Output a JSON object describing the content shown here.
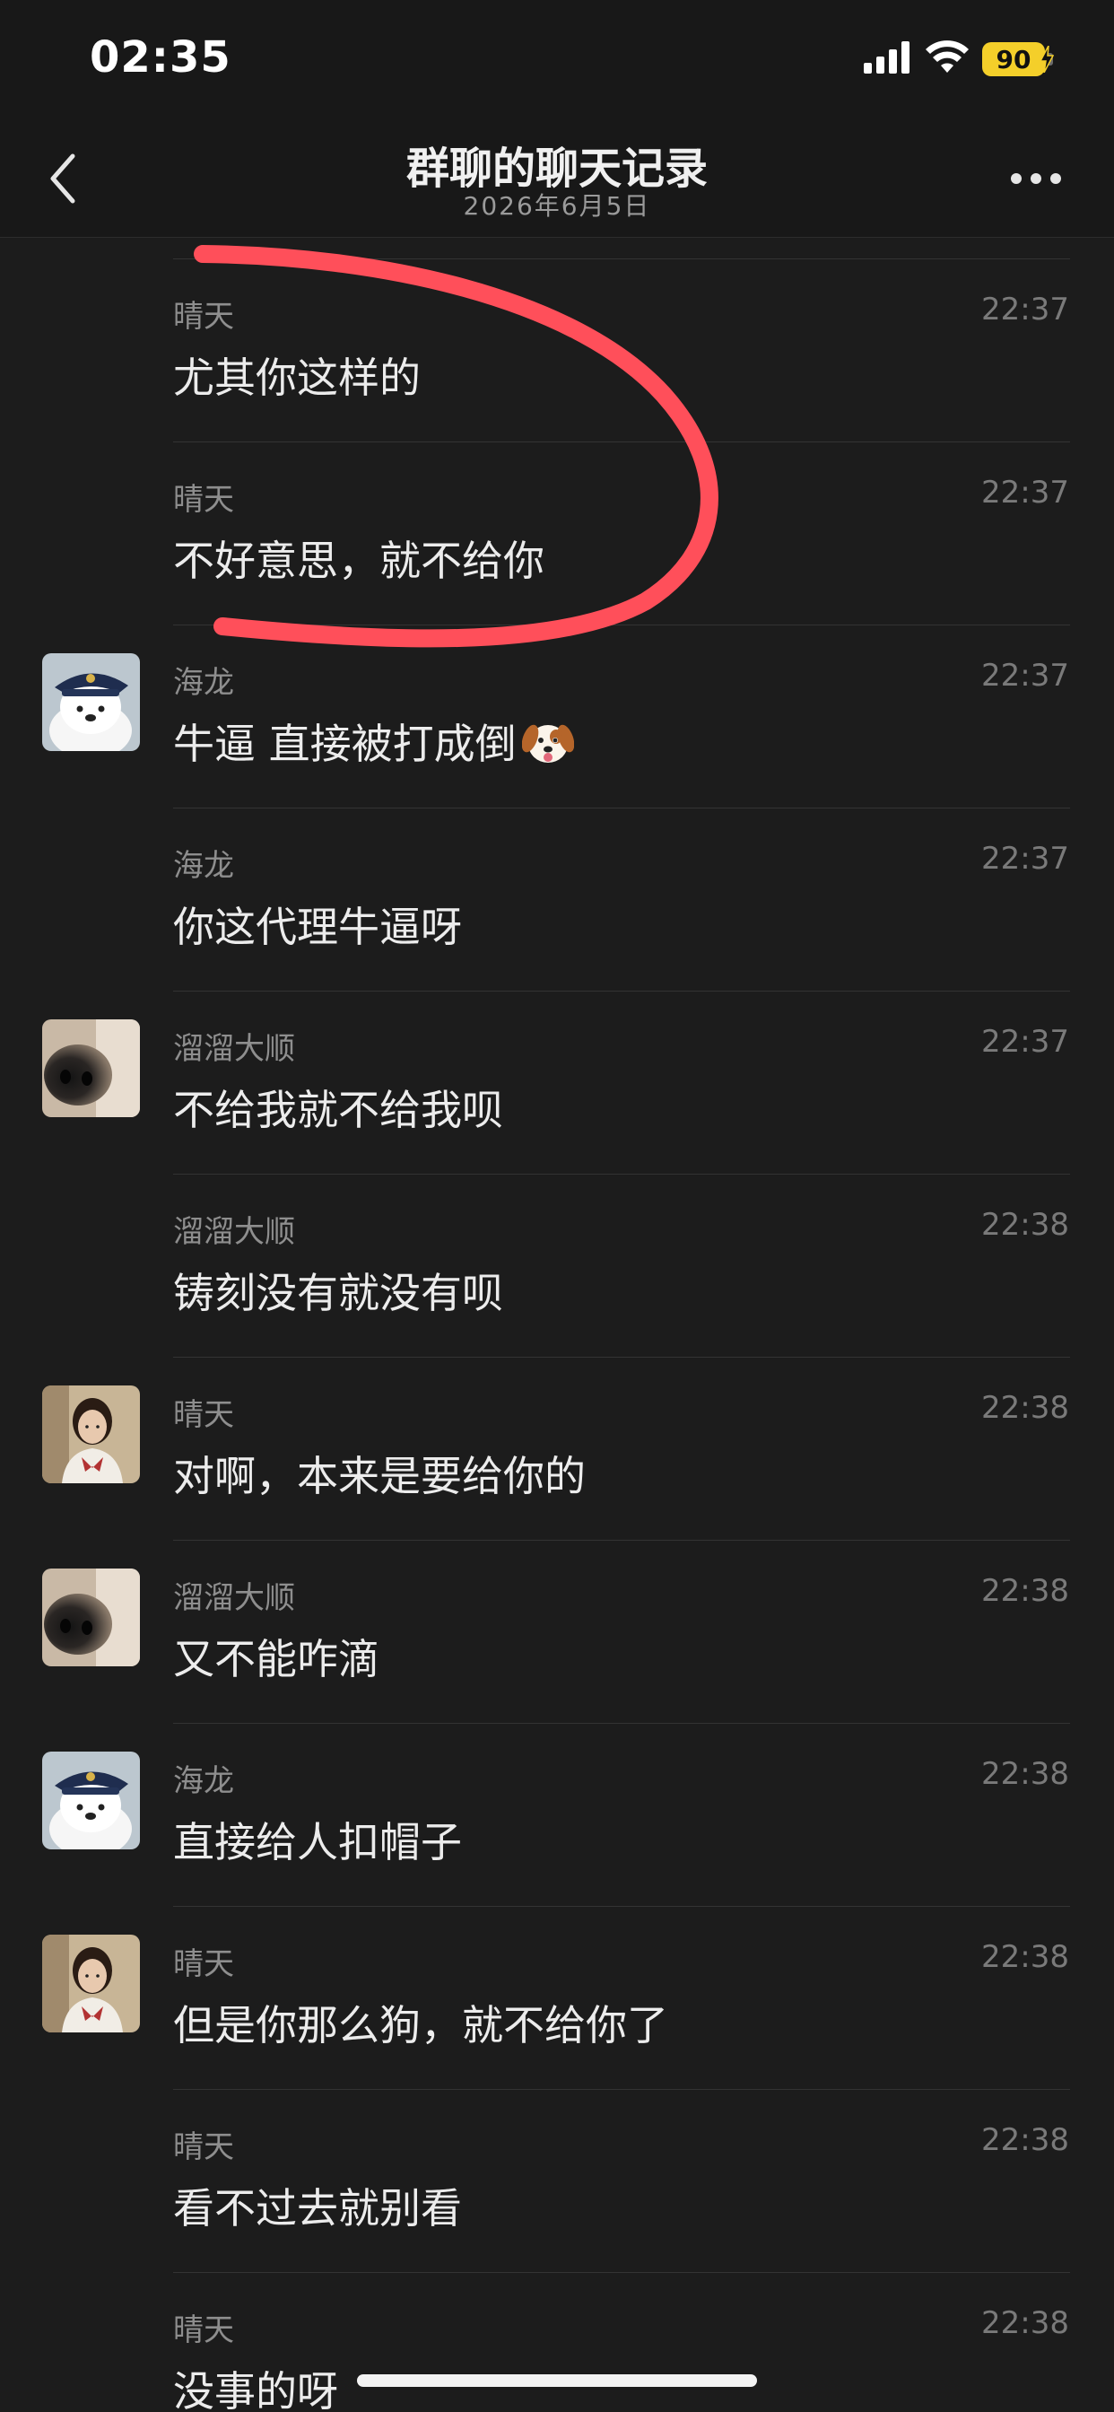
{
  "status_bar": {
    "time": "02:35",
    "battery_level": "90",
    "icons": [
      "cellular-signal-icon",
      "wifi-icon",
      "battery-charging-icon"
    ]
  },
  "nav": {
    "title": "群聊的聊天记录",
    "subtitle": "2026年6月5日",
    "back_icon": "chevron-left-icon",
    "more_icon": "more-dots-icon"
  },
  "colors": {
    "background": "#1c1c1c",
    "header": "#181818",
    "annotation_stroke": "#ff4f5a",
    "battery": "#f4cf2a"
  },
  "messages": [
    {
      "sender": "晴天",
      "time": "22:37",
      "text": "尤其你这样的",
      "avatar": ""
    },
    {
      "sender": "晴天",
      "time": "22:37",
      "text": "不好意思，就不给你",
      "avatar": ""
    },
    {
      "sender": "海龙",
      "time": "22:37",
      "text": "牛逼 直接被打成倒",
      "avatar": "polar-bear-avatar",
      "emoji": "dog-face-emoji"
    },
    {
      "sender": "海龙",
      "time": "22:37",
      "text": "你这代理牛逼呀",
      "avatar": ""
    },
    {
      "sender": "溜溜大顺",
      "time": "22:37",
      "text": "不给我就不给我呗",
      "avatar": "dog-nose-avatar"
    },
    {
      "sender": "溜溜大顺",
      "time": "22:38",
      "text": "铸刻没有就没有呗",
      "avatar": ""
    },
    {
      "sender": "晴天",
      "time": "22:38",
      "text": "对啊，本来是要给你的",
      "avatar": "girl-photo-avatar"
    },
    {
      "sender": "溜溜大顺",
      "time": "22:38",
      "text": "又不能咋滴",
      "avatar": "dog-nose-avatar"
    },
    {
      "sender": "海龙",
      "time": "22:38",
      "text": "直接给人扣帽子",
      "avatar": "polar-bear-avatar"
    },
    {
      "sender": "晴天",
      "time": "22:38",
      "text": "但是你那么狗，就不给你了",
      "avatar": "girl-photo-avatar"
    },
    {
      "sender": "晴天",
      "time": "22:38",
      "text": "看不过去就别看",
      "avatar": ""
    },
    {
      "sender": "晴天",
      "time": "22:38",
      "text": "没事的呀",
      "avatar": ""
    }
  ]
}
